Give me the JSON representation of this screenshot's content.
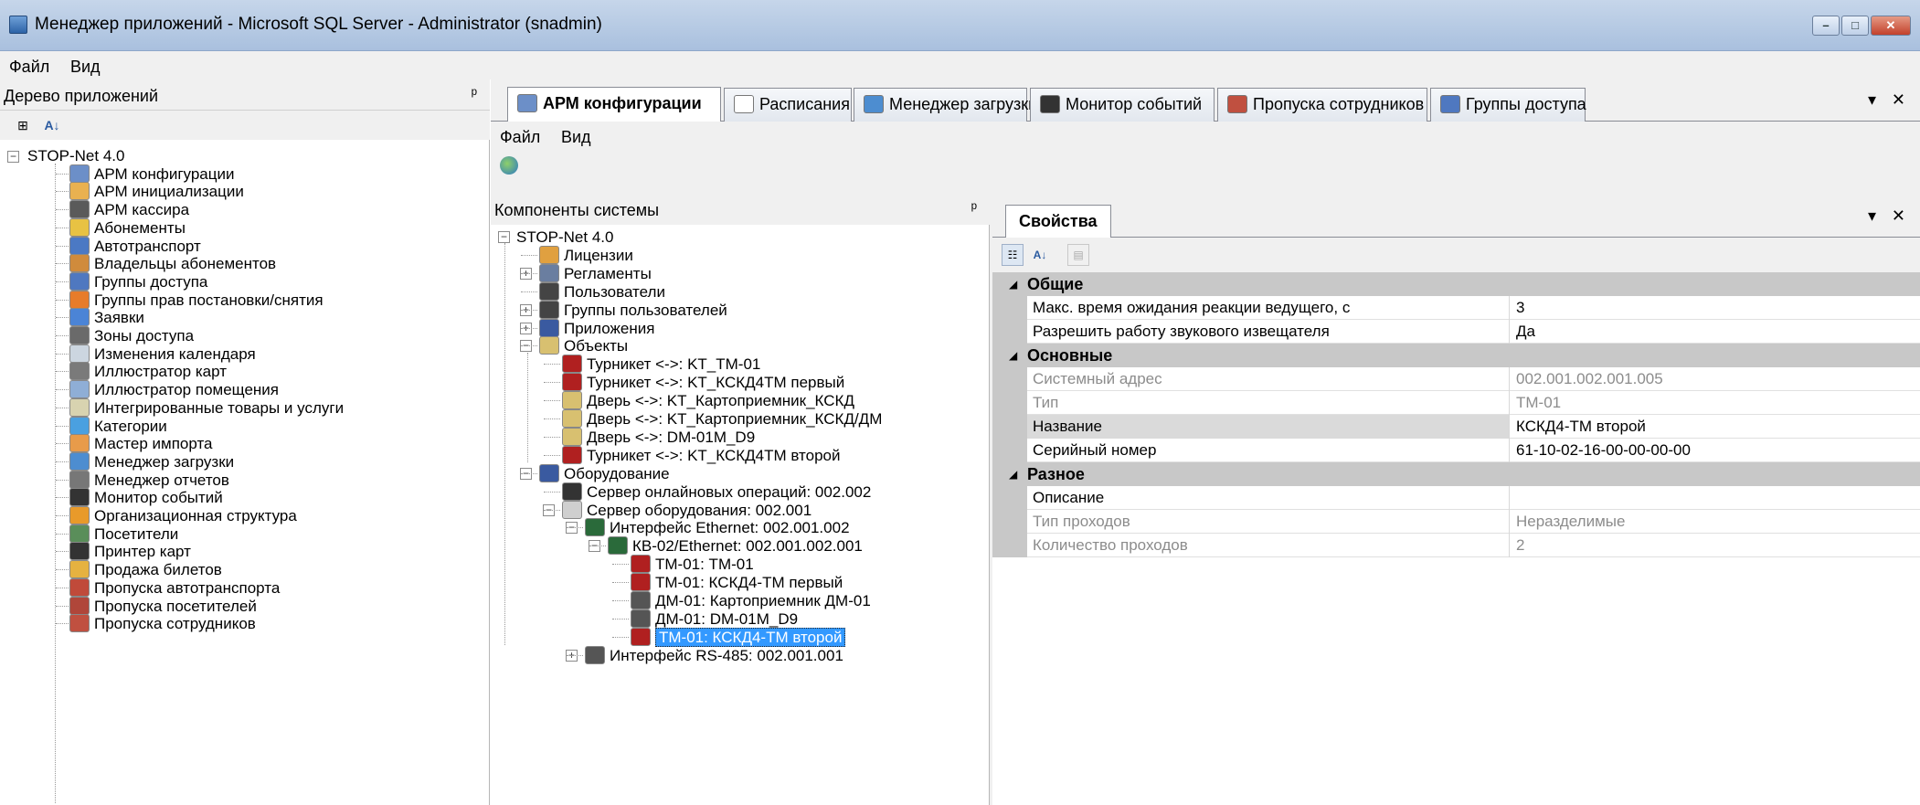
{
  "window": {
    "title": "Менеджер приложений - Microsoft SQL Server - Administrator  (snadmin)",
    "min": "–",
    "max": "□",
    "close": "✕"
  },
  "menu": {
    "file": "Файл",
    "view": "Вид"
  },
  "app_tree": {
    "title": "Дерево приложений",
    "pin": "ᵖ",
    "root": "STOP-Net 4.0",
    "items": [
      {
        "label": "АРМ конфигурации",
        "color": "#6c8fc8"
      },
      {
        "label": "АРМ инициализации",
        "color": "#e9b150"
      },
      {
        "label": "АРМ кассира",
        "color": "#5a5a5a"
      },
      {
        "label": "Абонементы",
        "color": "#e8c243"
      },
      {
        "label": "Автотранспорт",
        "color": "#4b79c4"
      },
      {
        "label": "Владельцы абонементов",
        "color": "#d08b3c"
      },
      {
        "label": "Группы доступа",
        "color": "#4f78c0"
      },
      {
        "label": "Группы прав постановки/снятия",
        "color": "#e77c2a"
      },
      {
        "label": "Заявки",
        "color": "#4b84d6"
      },
      {
        "label": "Зоны доступа",
        "color": "#6a6a6a"
      },
      {
        "label": "Изменения календаря",
        "color": "#ccd6e0"
      },
      {
        "label": "Иллюстратор карт",
        "color": "#7a7a7a"
      },
      {
        "label": "Иллюстратор помещения",
        "color": "#8faed6"
      },
      {
        "label": "Интегрированные товары и услуги",
        "color": "#d8d3b0"
      },
      {
        "label": "Категории",
        "color": "#4aa0e0"
      },
      {
        "label": "Мастер импорта",
        "color": "#e89b4a"
      },
      {
        "label": "Менеджер загрузки",
        "color": "#4d8dd0"
      },
      {
        "label": "Менеджер отчетов",
        "color": "#777777"
      },
      {
        "label": "Монитор событий",
        "color": "#333333"
      },
      {
        "label": "Организационная структура",
        "color": "#e89a2a"
      },
      {
        "label": "Посетители",
        "color": "#5a8e5a"
      },
      {
        "label": "Принтер карт",
        "color": "#333333"
      },
      {
        "label": "Продажа билетов",
        "color": "#e6b240"
      },
      {
        "label": "Пропуска автотранспорта",
        "color": "#c04a3a"
      },
      {
        "label": "Пропуска посетителей",
        "color": "#b0463a"
      },
      {
        "label": "Пропуска сотрудников",
        "color": "#c05040"
      }
    ]
  },
  "tabs": [
    {
      "label": "АРМ конфигурации",
      "color": "#6c8fc8"
    },
    {
      "label": "Расписания",
      "color": "#ffffff"
    },
    {
      "label": "Менеджер загрузки",
      "color": "#4d8dd0"
    },
    {
      "label": "Монитор событий",
      "color": "#333333"
    },
    {
      "label": "Пропуска сотрудников",
      "color": "#c05040"
    },
    {
      "label": "Группы доступа",
      "color": "#4f78c0"
    }
  ],
  "tab_controls": {
    "menu": "▾",
    "close": "✕"
  },
  "submenu": {
    "file": "Файл",
    "view": "Вид"
  },
  "components": {
    "title": "Компоненты системы",
    "pin": "ᵖ",
    "root": "STOP-Net 4.0",
    "licenses": "Лицензии",
    "regulations": "Регламенты",
    "users": "Пользователи",
    "user_groups": "Группы пользователей",
    "apps": "Приложения",
    "objects": "Объекты",
    "object_items": [
      "Турникет <->: KT_TM-01",
      "Турникет <->: KT_КСКД4ТМ первый",
      "Дверь <->: KT_Картоприемник_КСКД",
      "Дверь <->: KT_Картоприемник_КСКД/ДМ",
      "Дверь <->: DM-01M_D9",
      "Турникет <->: KT_КСКД4ТМ второй"
    ],
    "hardware": "Оборудование",
    "online_server": "Сервер онлайновых операций: 002.002",
    "hw_server": "Сервер оборудования: 002.001",
    "eth": "Интерфейс Ethernet: 002.001.002",
    "kb": "КВ-02/Ethernet: 002.001.002.001",
    "devices": [
      "ТМ-01: ТМ-01",
      "ТМ-01: КСКД4-ТМ первый",
      "ДМ-01: Картоприемник ДМ-01",
      "ДМ-01: DM-01M_D9"
    ],
    "selected": "ТМ-01: КСКД4-ТМ второй",
    "rs485": "Интерфейс RS-485: 002.001.001"
  },
  "properties": {
    "tab": "Свойства",
    "menu": "▾",
    "close": "✕",
    "categories": [
      {
        "name": "Общие",
        "rows": [
          {
            "k": "Макс. время ожидания реакции ведущего, с",
            "v": "3",
            "ro": false
          },
          {
            "k": "Разрешить работу звукового извещателя",
            "v": "Да",
            "ro": false
          }
        ]
      },
      {
        "name": "Основные",
        "rows": [
          {
            "k": "Системный адрес",
            "v": "002.001.002.001.005",
            "ro": true
          },
          {
            "k": "Тип",
            "v": "ТМ-01",
            "ro": true
          },
          {
            "k": "Название",
            "v": "КСКД4-ТМ второй",
            "ro": false,
            "hl": true
          },
          {
            "k": "Серийный номер",
            "v": "61-10-02-16-00-00-00-00",
            "ro": false
          }
        ]
      },
      {
        "name": "Разное",
        "rows": [
          {
            "k": "Описание",
            "v": "",
            "ro": false
          },
          {
            "k": "Тип проходов",
            "v": "Неразделимые",
            "ro": true
          },
          {
            "k": "Количество проходов",
            "v": "2",
            "ro": true
          }
        ]
      }
    ]
  }
}
